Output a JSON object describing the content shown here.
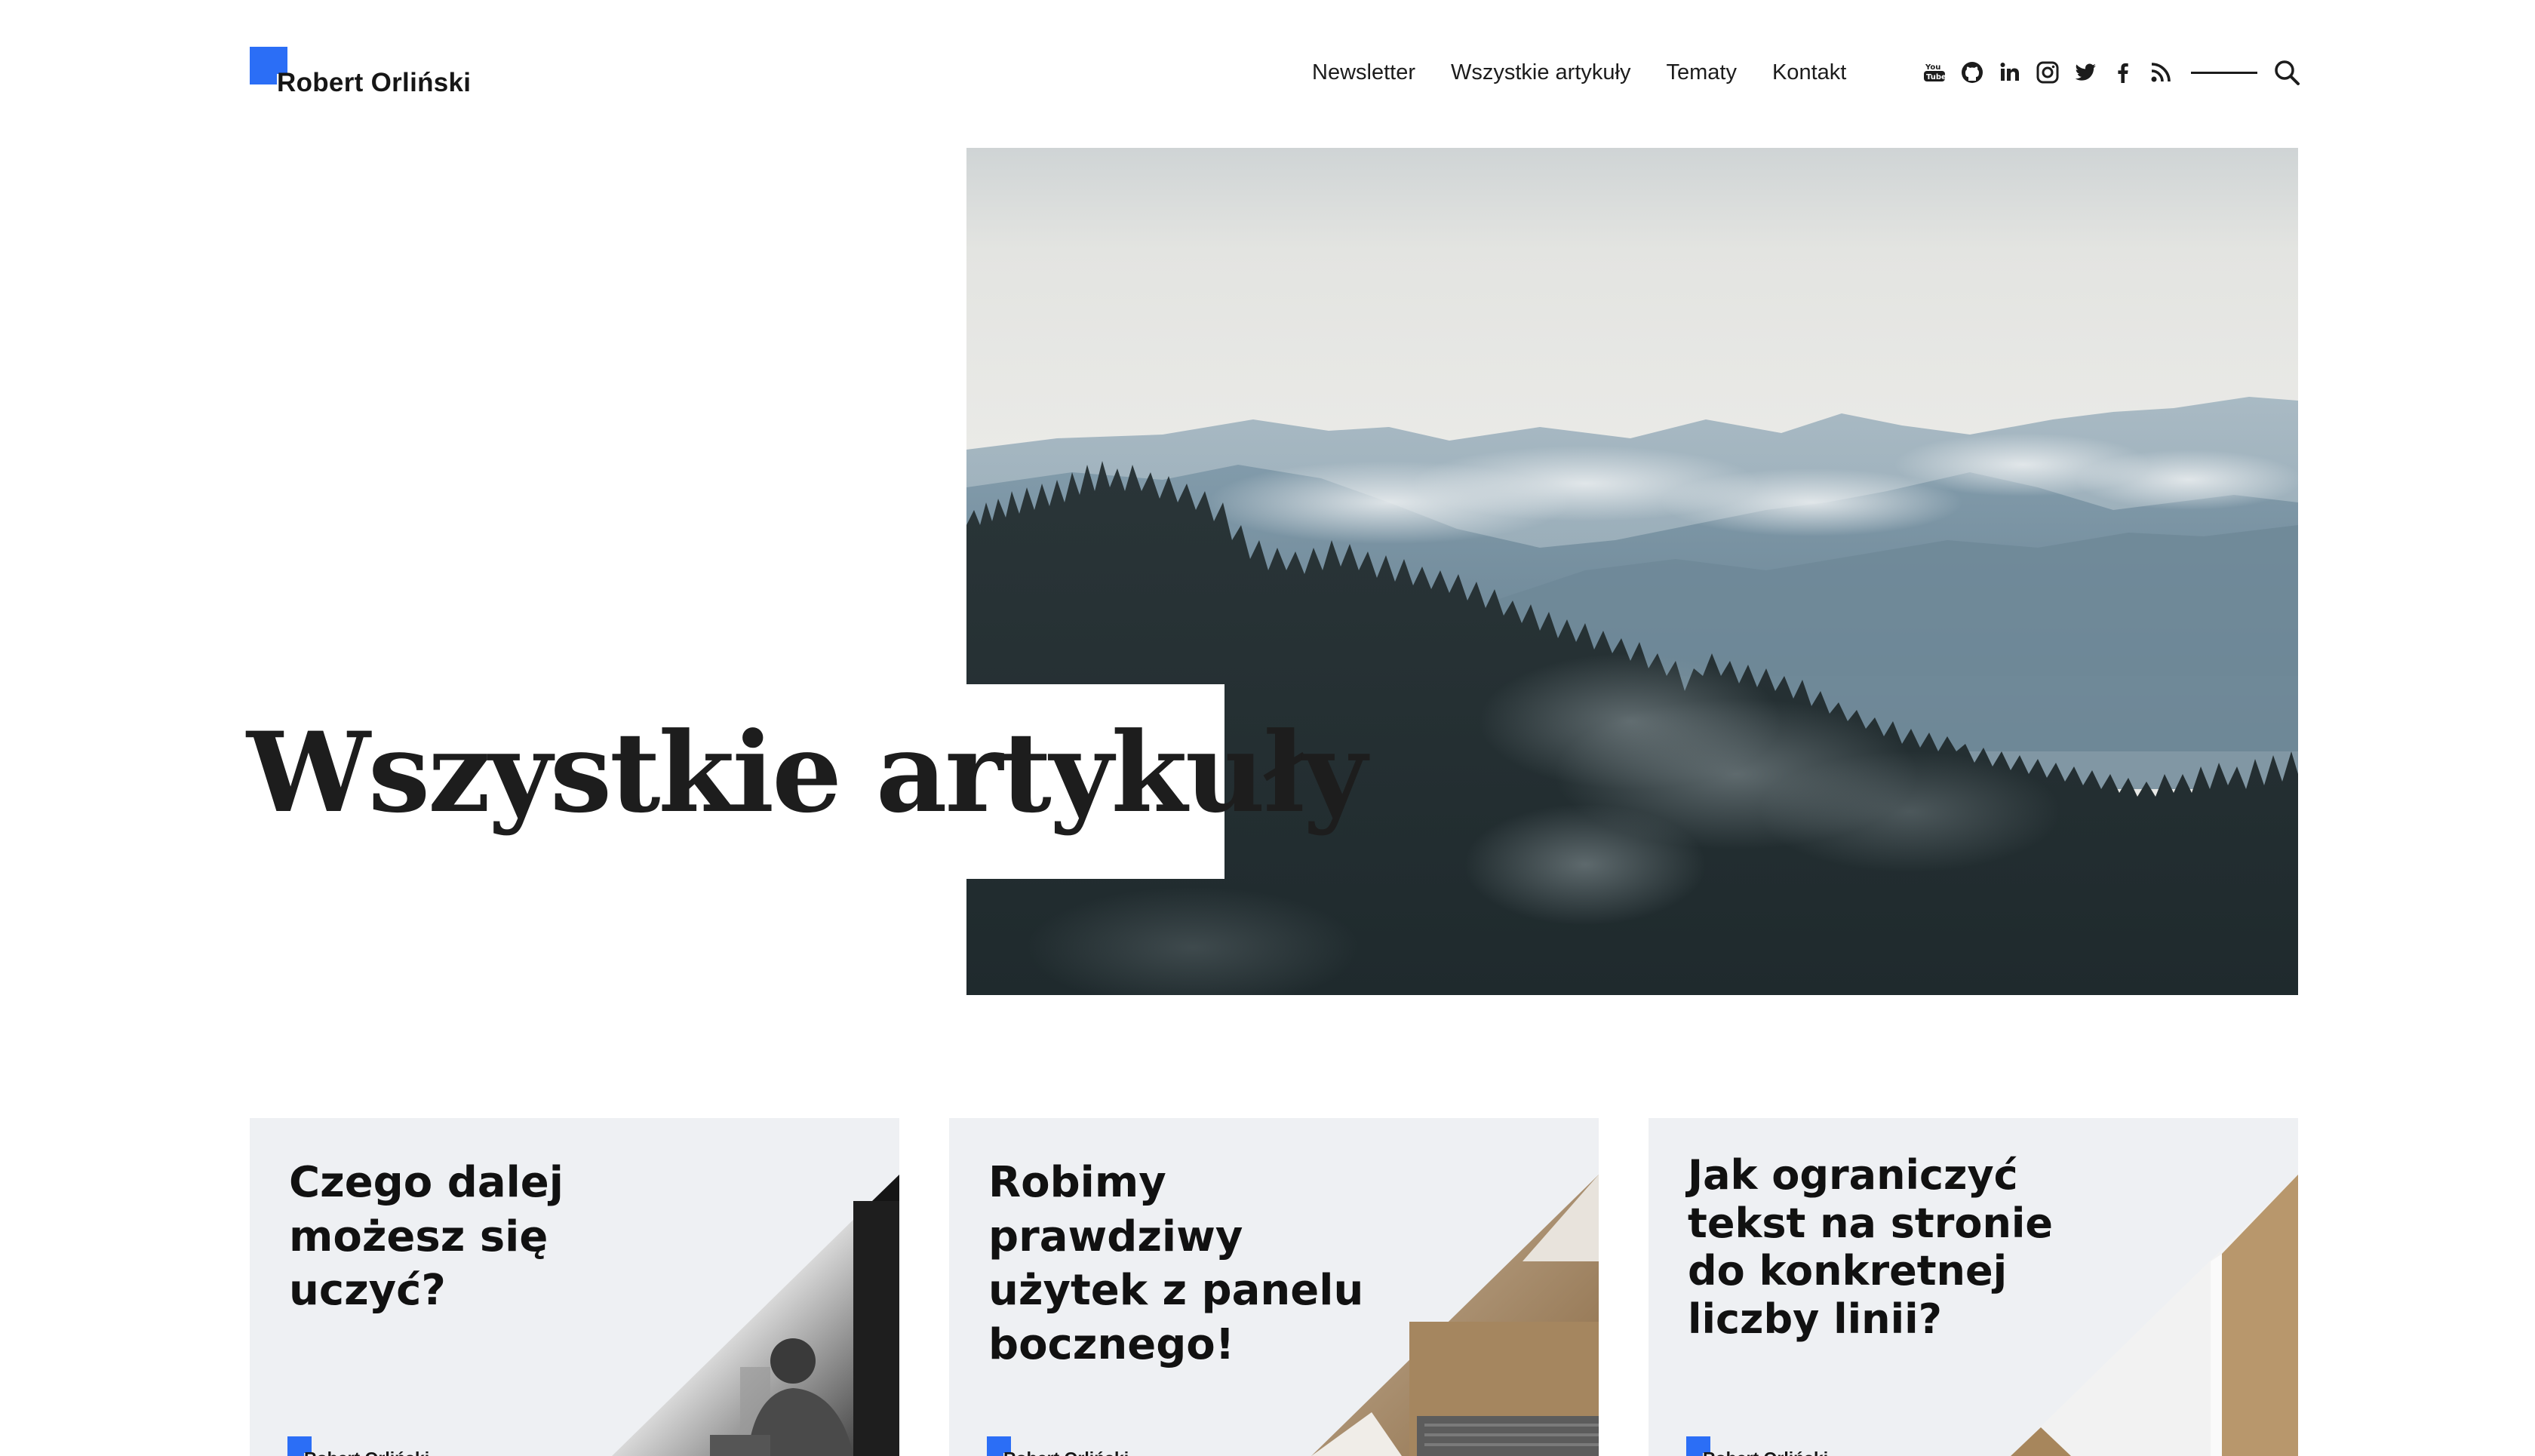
{
  "brand": {
    "name": "Robert Orliński",
    "accent": "#2b6ef6"
  },
  "nav": {
    "items": [
      "Newsletter",
      "Wszystkie artykuły",
      "Tematy",
      "Kontakt"
    ]
  },
  "social": [
    "youtube-icon",
    "github-icon",
    "linkedin-icon",
    "instagram-icon",
    "twitter-icon",
    "facebook-icon",
    "rss-icon"
  ],
  "hero": {
    "title": "Wszystkie artykuły"
  },
  "cards": [
    {
      "title": "Czego dalej możesz się uczyć?",
      "brand": "Robert Orliński"
    },
    {
      "title": "Robimy prawdziwy użytek z panelu bocznego!",
      "brand": "Robert Orliński"
    },
    {
      "title": "Jak ograniczyć tekst na stronie do konkretnej liczby linii?",
      "brand": "Robert Orliński"
    }
  ]
}
